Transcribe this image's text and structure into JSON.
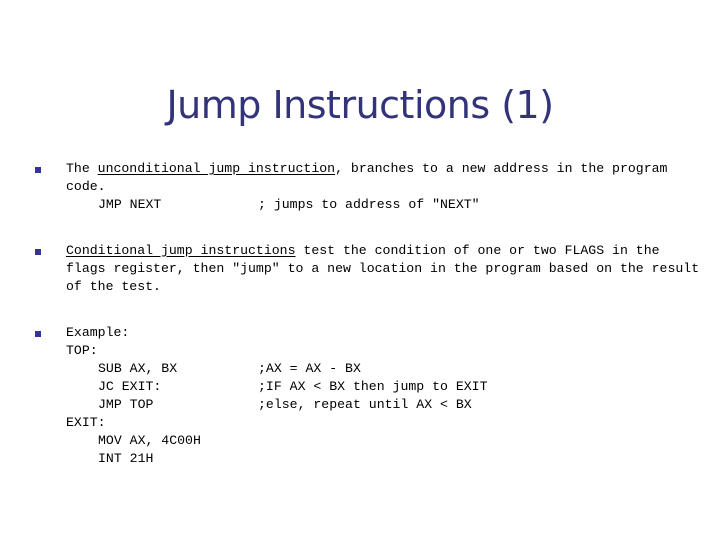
{
  "slide": {
    "title": "Jump Instructions (1)",
    "title_color": "#33337a",
    "bullet_color": "#33339a",
    "background_color": "#ffffff",
    "bullets": [
      {
        "id": "unconditional-jump",
        "marker": "square-bullet",
        "text_before_underline": "The ",
        "underlined_text": "unconditional jump instruction",
        "text_after_underline": ", branches to a new address in the program code.",
        "code": {
          "mnemonic": "JMP NEXT",
          "comment": "; jumps to address of \"NEXT\""
        }
      },
      {
        "id": "conditional-jump",
        "marker": "square-bullet",
        "text_before_underline": "",
        "underlined_text": "Conditional jump instructions",
        "text_after_underline": " test the condition of one or two FLAGS in the flags register, then \"jump\" to a new location in the program based on the result of the test."
      },
      {
        "id": "example",
        "marker": "square-bullet",
        "label": "Example:",
        "listing": [
          {
            "indent": 0,
            "mnemonic": "TOP:",
            "comment": ""
          },
          {
            "indent": 1,
            "mnemonic": "SUB AX, BX",
            "comment": ";AX = AX - BX"
          },
          {
            "indent": 1,
            "mnemonic": "JC EXIT:",
            "comment": ";IF AX < BX then jump to EXIT"
          },
          {
            "indent": 1,
            "mnemonic": "JMP TOP",
            "comment": ";else, repeat until AX < BX"
          },
          {
            "indent": 0,
            "mnemonic": "EXIT:",
            "comment": ""
          },
          {
            "indent": 1,
            "mnemonic": "MOV AX, 4C00H",
            "comment": ""
          },
          {
            "indent": 1,
            "mnemonic": "INT 21H",
            "comment": ""
          }
        ]
      }
    ]
  }
}
